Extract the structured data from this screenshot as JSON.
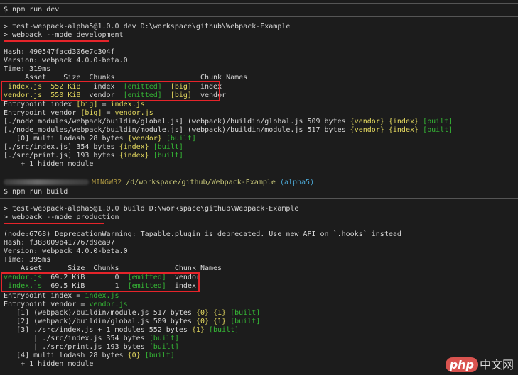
{
  "top_sep_line": true,
  "dev": {
    "cmd": "$ npm run dev",
    "run_line": "> test-webpack-alpha5@1.0.0 dev D:\\workspace\\github\\Webpack-Example",
    "webpack_line": "> webpack --mode development",
    "hash": "Hash: 490547facd306e7c304f",
    "version": "Version: webpack 4.0.0-beta.0",
    "time": "Time: 319ms",
    "table_header": "     Asset    Size  Chunks                    Chunk Names",
    "rows": [
      {
        "asset": " index.js",
        "size": "  552 KiB",
        "chunks": "   index",
        "emitted": "[emitted]",
        "big": "[big]",
        "name": "index"
      },
      {
        "asset": "vendor.js",
        "size": "  550 KiB",
        "chunks": "  vendor",
        "emitted": "[emitted]",
        "big": "[big]",
        "name": "vendor"
      }
    ],
    "entry1": {
      "pre": "Entrypoint index ",
      "big": "[big]",
      "mid": " = ",
      "file": "index.js"
    },
    "entry2": {
      "pre": "Entrypoint vendor ",
      "big": "[big]",
      "mid": " = ",
      "file": "vendor.js"
    },
    "mod1": {
      "text": "[./node_modules/webpack/buildin/global.js] (webpack)/buildin/global.js 509 bytes ",
      "t1": "{vendor}",
      "t2": "{index}",
      "t3": "[built]"
    },
    "mod2": {
      "text": "[./node_modules/webpack/buildin/module.js] (webpack)/buildin/module.js 517 bytes ",
      "t1": "{vendor}",
      "t2": "{index}",
      "t3": "[built]"
    },
    "mod3": {
      "text": "   [0] multi lodash 28 bytes ",
      "t1": "{vendor}",
      "t3": "[built]"
    },
    "mod4": {
      "text": "[./src/index.js] 354 bytes ",
      "t1": "{index}",
      "t3": "[built]"
    },
    "mod5": {
      "text": "[./src/print.js] 193 bytes ",
      "t1": "{index}",
      "t3": "[built]"
    },
    "hidden": "    + 1 hidden module"
  },
  "prompt": {
    "shell": "MINGW32",
    "path": "/d/workspace/github/Webpack-Example",
    "branch": "(alpha5)"
  },
  "build": {
    "cmd": "$ npm run build",
    "run_line": "> test-webpack-alpha5@1.0.0 build D:\\workspace\\github\\Webpack-Example",
    "webpack_line": "> webpack --mode production",
    "deprecation": "(node:6768) DeprecationWarning: Tapable.plugin is deprecated. Use new API on `.hooks` instead",
    "hash": "Hash: f383009b417767d9ea97",
    "version": "Version: webpack 4.0.0-beta.0",
    "time": "Time: 395ms",
    "table_header": "    Asset      Size  Chunks             Chunk Names",
    "rows": [
      {
        "asset": "vendor.js",
        "size": "  69.2 KiB",
        "chunks": "       0",
        "emitted": "[emitted]",
        "name": "vendor"
      },
      {
        "asset": " index.js",
        "size": "  69.5 KiB",
        "chunks": "       1",
        "emitted": "[emitted]",
        "name": "index"
      }
    ],
    "entry1": {
      "pre": "Entrypoint index = ",
      "file": "index.js"
    },
    "entry2": {
      "pre": "Entrypoint vendor = ",
      "file": "vendor.js"
    },
    "mod1": {
      "text": "   [1] (webpack)/buildin/module.js 517 bytes ",
      "t1": "{0}",
      "t2": "{1}",
      "t3": "[built]"
    },
    "mod2": {
      "text": "   [2] (webpack)/buildin/global.js 509 bytes ",
      "t1": "{0}",
      "t2": "{1}",
      "t3": "[built]"
    },
    "mod3": {
      "text": "   [3] ./src/index.js + 1 modules 552 bytes ",
      "t1": "{1}",
      "t3": "[built]"
    },
    "mod4": {
      "text": "       | ./src/index.js 354 bytes ",
      "t3": "[built]"
    },
    "mod5": {
      "text": "       | ./src/print.js 193 bytes ",
      "t3": "[built]"
    },
    "mod6": {
      "text": "   [4] multi lodash 28 bytes ",
      "t1": "{0}",
      "t3": "[built]"
    },
    "hidden": "    + 1 hidden module"
  },
  "watermark": {
    "logo": "php",
    "text": "中文网"
  }
}
